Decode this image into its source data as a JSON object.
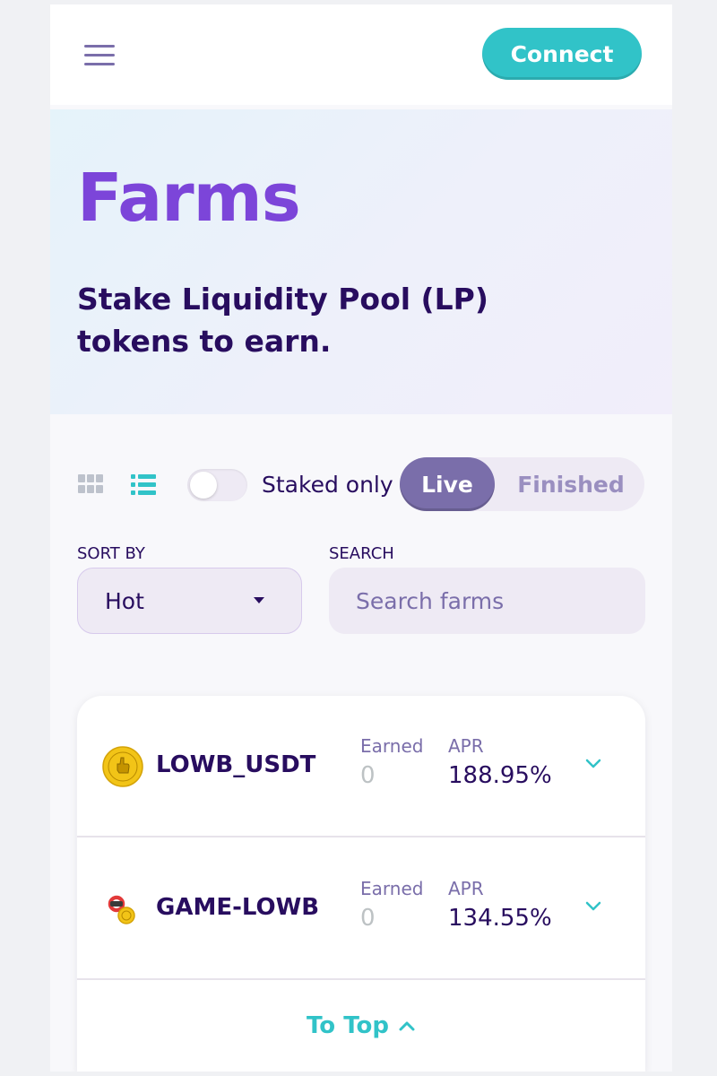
{
  "header": {
    "menu_icon": "hamburger-menu-icon",
    "connect_label": "Connect"
  },
  "hero": {
    "title": "Farms",
    "subtitle": "Stake Liquidity Pool (LP) tokens to earn."
  },
  "controls": {
    "view_icons": [
      "grid-view-icon",
      "list-view-icon"
    ],
    "active_view": "list",
    "staked_only_label": "Staked only",
    "staked_only_on": false,
    "tabs": [
      {
        "label": "Live",
        "active": true
      },
      {
        "label": "Finished",
        "active": false
      }
    ],
    "sort_label": "SORT BY",
    "sort_value": "Hot",
    "search_label": "SEARCH",
    "search_placeholder": "Search farms",
    "search_value": ""
  },
  "farms": [
    {
      "name": "LOWB_USDT",
      "earned_label": "Earned",
      "earned": "0",
      "apr_label": "APR",
      "apr": "188.95%",
      "icon": "lowb-token-icon"
    },
    {
      "name": "GAME-LOWB",
      "earned_label": "Earned",
      "earned": "0",
      "apr_label": "APR",
      "apr": "134.55%",
      "icon": "game-lowb-token-icon"
    }
  ],
  "to_top_label": "To Top",
  "colors": {
    "primary_text": "#280d5f",
    "accent_teal": "#31c3c8",
    "accent_purple": "#7c45d9",
    "muted_purple": "#7a6eaa"
  }
}
